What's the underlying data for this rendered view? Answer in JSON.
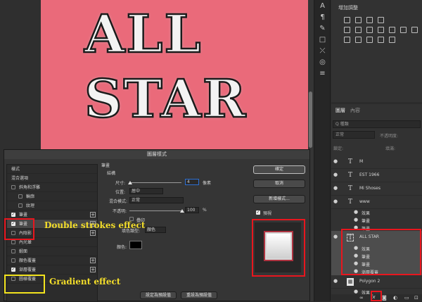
{
  "canvas": {
    "line1": "ALL",
    "line2": "STAR",
    "background_color": "#ea6a7a"
  },
  "tools": [
    "type-icon",
    "paragraph-icon",
    "brush-icon",
    "shape-icon",
    "transform-icon",
    "clone-icon",
    "sliders-icon"
  ],
  "adjustments": {
    "title": "增加調整",
    "icons": [
      "brightness-icon",
      "levels-icon",
      "curves-icon",
      "exposure-icon",
      "vibrance-icon",
      "hue-icon",
      "color-balance-icon",
      "bw-icon",
      "photo-filter-icon",
      "channel-mixer-icon",
      "lookup-icon",
      "invert-icon",
      "posterize-icon",
      "threshold-icon",
      "gradient-map-icon",
      "selective-color-icon"
    ]
  },
  "layers_panel": {
    "tabs": [
      "圖層",
      "內容"
    ],
    "filter_label": "Q 種類",
    "blend_mode": "正常",
    "opacity_label": "不透明度:",
    "lock_label": "鎖定:",
    "fill_label": "填滿:",
    "layers": [
      {
        "name": "M",
        "kind": "T"
      },
      {
        "name": "EST 1966",
        "kind": "T"
      },
      {
        "name": "Mi Shoses",
        "kind": "T"
      },
      {
        "name": "www",
        "kind": "T"
      }
    ],
    "www_effects": [
      "效果",
      "筆畫",
      "筆畫"
    ],
    "selected_layer": "ALL STAR",
    "all_star_effects": [
      "效果",
      "筆畫",
      "筆畫",
      "漸層覆蓋"
    ],
    "polygon_layer": "Polygon 2",
    "polygon_effect": "效果",
    "footer_icons": [
      "link-icon",
      "fx-icon",
      "mask-icon",
      "adjustment-icon",
      "folder-icon",
      "new-layer-icon",
      "trash-icon"
    ],
    "fx_label": "fx"
  },
  "dialog": {
    "title": "圖層樣式",
    "style_list": [
      {
        "label": "樣式",
        "checkbox": false,
        "plus": false
      },
      {
        "label": "混合選項",
        "checkbox": false,
        "plus": false
      },
      {
        "label": "斜角和浮雕",
        "checkbox": "off",
        "plus": false
      },
      {
        "label": "輪廓",
        "checkbox": "off",
        "plus": false,
        "indent": true
      },
      {
        "label": "紋理",
        "checkbox": "off",
        "plus": false,
        "indent": true
      },
      {
        "label": "筆畫",
        "checkbox": "on",
        "plus": true
      },
      {
        "label": "筆畫",
        "checkbox": "on",
        "plus": true
      },
      {
        "label": "內陰影",
        "checkbox": "off",
        "plus": true
      },
      {
        "label": "內光暈",
        "checkbox": "off",
        "plus": false
      },
      {
        "label": "緞面",
        "checkbox": "off",
        "plus": false
      },
      {
        "label": "顏色覆蓋",
        "checkbox": "off",
        "plus": true
      },
      {
        "label": "漸層覆蓋",
        "checkbox": "on",
        "plus": true
      },
      {
        "label": "圖樣覆蓋",
        "checkbox": "off",
        "plus": false
      }
    ],
    "section": "筆畫",
    "structure": "結構",
    "size_label": "尺寸:",
    "size_value": "4",
    "size_unit": "像素",
    "position_label": "位置:",
    "position_value": "居中",
    "blend_label": "混合模式:",
    "blend_value": "正常",
    "opacity_label": "不透明:",
    "opacity_value": "100",
    "opacity_unit": "%",
    "overprint_label": "疊印",
    "fill_type_label": "填色類型:",
    "fill_type_value": "顏色",
    "color_label": "顏色:",
    "buttons": {
      "ok": "確定",
      "cancel": "取消",
      "new_style": "新增樣式...",
      "preview": "預視"
    },
    "bottom_buttons": [
      "設定為預設值",
      "重設為預設值"
    ]
  },
  "annotations": {
    "double_strokes": "Double strokes effect",
    "gradient": "Gradient effect"
  },
  "colors": {
    "annotation_red": "#e8161e",
    "annotation_yellow": "#f2e31e"
  }
}
